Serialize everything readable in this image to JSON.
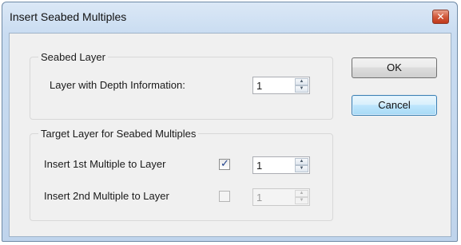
{
  "window": {
    "title": "Insert Seabed Multiples",
    "close_glyph": "✕"
  },
  "seabed_layer": {
    "title": "Seabed Layer",
    "label": "Layer with Depth Information:",
    "value": "1"
  },
  "target_layer": {
    "title": "Target Layer for Seabed Multiples",
    "first": {
      "label": "Insert 1st Multiple to Layer",
      "checked": true,
      "value": "1",
      "enabled": true
    },
    "second": {
      "label": "Insert 2nd Multiple to Layer",
      "checked": false,
      "value": "1",
      "enabled": false
    }
  },
  "buttons": {
    "ok_label": "OK",
    "cancel_label": "Cancel"
  },
  "glyphs": {
    "check": "✓",
    "arrow_up": "▲",
    "arrow_down": "▼"
  },
  "colors": {
    "title_bar": "#c9dcf1",
    "close_button": "#d25a3c",
    "dialog_bg": "#f0f0f0",
    "focus_button": "#bee6fd"
  }
}
